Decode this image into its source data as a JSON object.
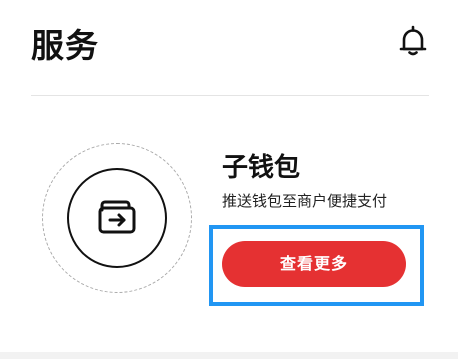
{
  "header": {
    "title": "服务",
    "notification_icon": "bell-icon"
  },
  "wallet_card": {
    "icon": "wallet-transfer-icon",
    "title": "子钱包",
    "description": "推送钱包至商户便捷支付",
    "button_label": "查看更多"
  },
  "colors": {
    "accent_button": "#e53132",
    "highlight_outline": "#2196f3",
    "text_primary": "#111111",
    "divider": "#e4e4e4"
  }
}
